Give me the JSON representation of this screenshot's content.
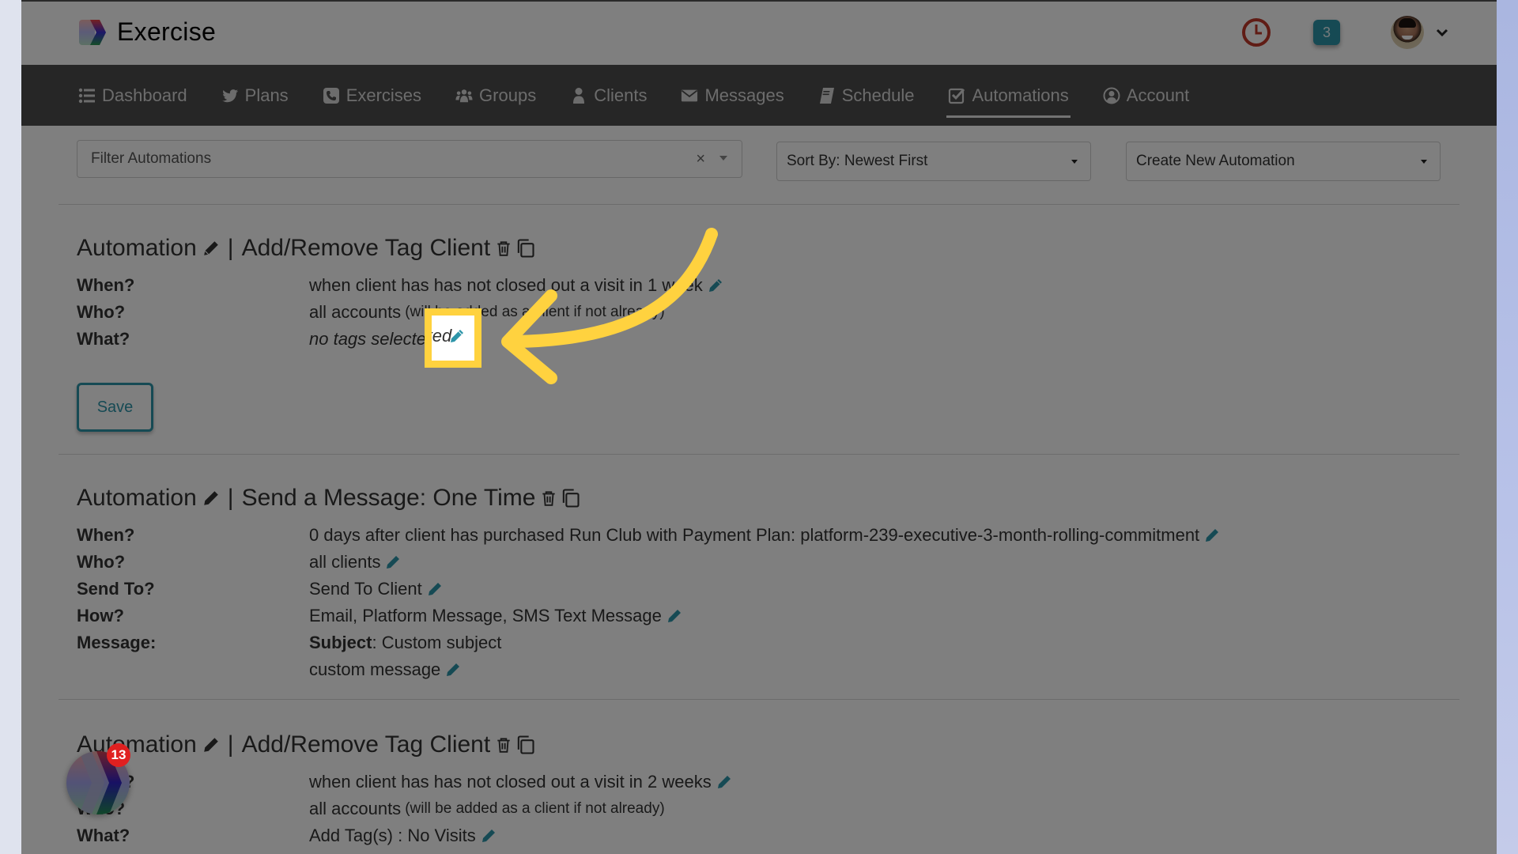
{
  "header": {
    "brand_name": "Exercise",
    "notification_count": "3",
    "icons": {
      "clock": "clock-icon",
      "avatar": "user-avatar",
      "chevron": "chevron-down-icon"
    }
  },
  "nav": {
    "items": [
      {
        "label": "Dashboard",
        "icon": "list-icon",
        "active": false
      },
      {
        "label": "Plans",
        "icon": "twitter-bird-icon",
        "active": false
      },
      {
        "label": "Exercises",
        "icon": "phone-square-icon",
        "active": false
      },
      {
        "label": "Groups",
        "icon": "users-icon",
        "active": false
      },
      {
        "label": "Clients",
        "icon": "user-icon",
        "active": false
      },
      {
        "label": "Messages",
        "icon": "envelope-icon",
        "active": false
      },
      {
        "label": "Schedule",
        "icon": "book-icon",
        "active": false
      },
      {
        "label": "Automations",
        "icon": "check-square-icon",
        "active": true
      },
      {
        "label": "Account",
        "icon": "user-circle-icon",
        "active": false
      }
    ]
  },
  "toolbar": {
    "filter_placeholder": "Filter Automations",
    "filter_clear": "×",
    "sort_label": "Sort By: Newest First",
    "create_label": "Create New Automation"
  },
  "automations": [
    {
      "title_prefix": "Automation",
      "separator": "|",
      "type": "Add/Remove Tag Client",
      "rows": [
        {
          "label": "When?",
          "value": "when client has has not closed out a visit in 1 week",
          "note": ""
        },
        {
          "label": "Who?",
          "value": "all accounts",
          "note": "(will be added as a client if not already)"
        },
        {
          "label": "What?",
          "value": "no tags selected",
          "note": ""
        }
      ],
      "save_label": "Save"
    },
    {
      "title_prefix": "Automation",
      "separator": "|",
      "type": "Send a Message: One Time",
      "rows": [
        {
          "label": "When?",
          "value": "0 days after client has purchased Run Club with Payment Plan: platform-239-executive-3-month-rolling-commitment"
        },
        {
          "label": "Who?",
          "value": "all clients"
        },
        {
          "label": "Send To?",
          "value": "Send To Client"
        },
        {
          "label": "How?",
          "value": "Email, Platform Message, SMS Text Message"
        },
        {
          "label": "Message:",
          "subject_label": "Subject",
          "subject_value": ": Custom subject",
          "value": "custom message"
        }
      ]
    },
    {
      "title_prefix": "Automation",
      "separator": "|",
      "type": "Add/Remove Tag Client",
      "rows": [
        {
          "label": "When?",
          "value": "when client has has not closed out a visit in 2 weeks"
        },
        {
          "label": "Who?",
          "value": "all accounts",
          "note": "(will be added as a client if not already)"
        },
        {
          "label": "What?",
          "value": "Add Tag(s) : No Visits"
        }
      ]
    }
  ],
  "widget": {
    "badge_count": "13"
  },
  "colors": {
    "accent": "#2d95a9",
    "nav_bg": "#4c4c4c",
    "annotation": "#ffd23f",
    "clock": "#c0392b",
    "badge_red": "#e02020"
  }
}
